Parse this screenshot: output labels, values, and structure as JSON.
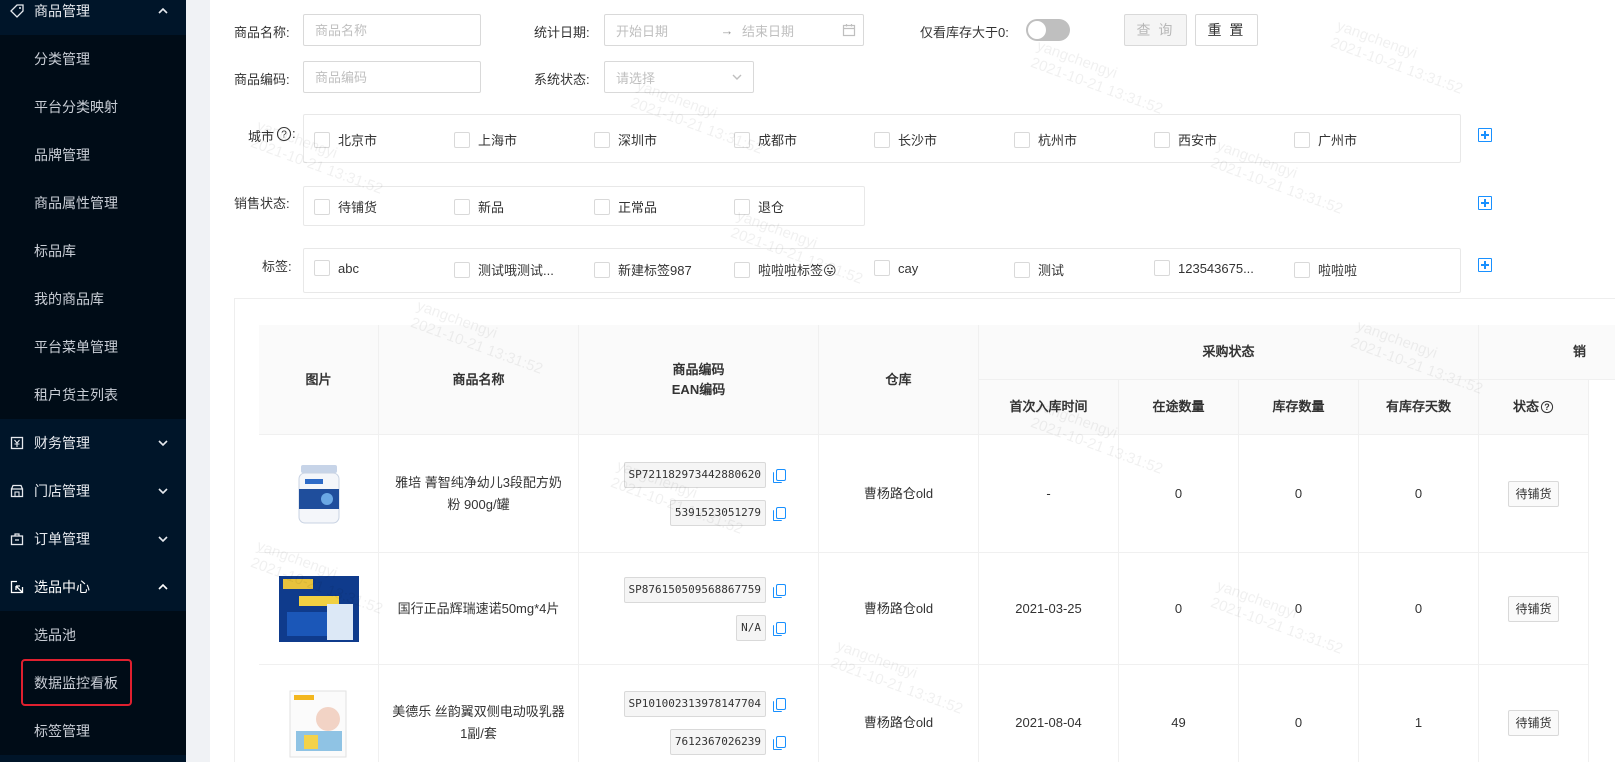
{
  "sidebar": {
    "groups": [
      {
        "label": "商品管理",
        "icon": "tag-icon",
        "expanded": true
      },
      {
        "label": "财务管理",
        "icon": "finance-icon",
        "expanded": false
      },
      {
        "label": "门店管理",
        "icon": "store-icon",
        "expanded": false
      },
      {
        "label": "订单管理",
        "icon": "order-icon",
        "expanded": false
      },
      {
        "label": "选品中心",
        "icon": "select-icon",
        "expanded": true
      }
    ],
    "goods_items": [
      "分类管理",
      "平台分类映射",
      "品牌管理",
      "商品属性管理",
      "标品库",
      "我的商品库",
      "平台菜单管理",
      "租户货主列表"
    ],
    "select_items": [
      "选品池",
      "数据监控看板",
      "标签管理"
    ],
    "highlighted_item": "数据监控看板"
  },
  "filters": {
    "name_label": "商品名称:",
    "name_placeholder": "商品名称",
    "date_label": "统计日期:",
    "date_start_placeholder": "开始日期",
    "date_end_placeholder": "结束日期",
    "stock_label": "仅看库存大于0:",
    "stock_toggle_on": false,
    "query_label": "查 询",
    "reset_label": "重 置",
    "code_label": "商品编码:",
    "code_placeholder": "商品编码",
    "status_label": "系统状态:",
    "status_placeholder": "请选择",
    "city_label": "城市",
    "cities": [
      "北京市",
      "上海市",
      "深圳市",
      "成都市",
      "长沙市",
      "杭州市",
      "西安市",
      "广州市"
    ],
    "sale_label": "销售状态:",
    "sale_states": [
      "待铺货",
      "新品",
      "正常品",
      "退仓"
    ],
    "tag_label": "标签:",
    "tags": [
      "abc",
      "测试哦测试...",
      "新建标签987",
      "啦啦啦标签😛",
      "cay",
      "测试",
      "123543675...",
      "啦啦啦"
    ]
  },
  "table": {
    "headers": {
      "image": "图片",
      "name": "商品名称",
      "code": "商品编码",
      "ean": "EAN编码",
      "warehouse": "仓库",
      "purchase_group": "采购状态",
      "sale_group": "销",
      "first_in": "首次入库时间",
      "in_transit": "在途数量",
      "stock": "库存数量",
      "stock_days": "有库存天数",
      "status": "状态"
    },
    "rows": [
      {
        "name": "雅培 菁智纯净幼儿3段配方奶粉 900g/罐",
        "code": "SP721182973442880620",
        "ean": "5391523051279",
        "warehouse": "曹杨路仓old",
        "first_in": "-",
        "in_transit": "0",
        "stock": "0",
        "stock_days": "0",
        "status": "待铺货"
      },
      {
        "name": "国行正品辉瑞速诺50mg*4片",
        "code": "SP876150509568867759",
        "ean": "N/A",
        "warehouse": "曹杨路仓old",
        "first_in": "2021-03-25",
        "in_transit": "0",
        "stock": "0",
        "stock_days": "0",
        "status": "待铺货"
      },
      {
        "name": "美德乐 丝韵翼双侧电动吸乳器 1副/套",
        "code": "SP101002313978147704",
        "ean": "7612367026239",
        "warehouse": "曹杨路仓old",
        "first_in": "2021-08-04",
        "in_transit": "49",
        "stock": "0",
        "stock_days": "1",
        "status": "待铺货"
      }
    ]
  },
  "watermark": {
    "user": "yangchengyi",
    "time": "2021-10-21 13:31:52"
  }
}
